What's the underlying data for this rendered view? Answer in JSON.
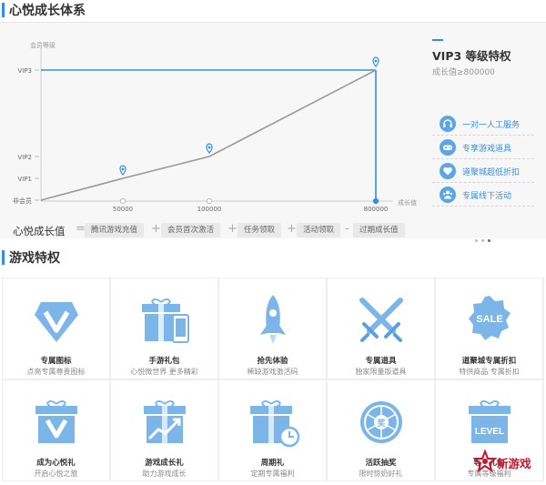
{
  "growth_section": {
    "title": "心悦成长体系",
    "vip_title": "VIP3 等级特权",
    "vip_requirement": "成长值≥800000",
    "perks": [
      {
        "label": "一对一人工服务",
        "icon": "headset-icon"
      },
      {
        "label": "专享游戏道具",
        "icon": "gamepad-icon"
      },
      {
        "label": "道聚城超低折扣",
        "icon": "heart-tag-icon"
      },
      {
        "label": "专属线下活动",
        "icon": "group-icon"
      }
    ]
  },
  "chart_data": {
    "type": "line",
    "ylabel": "会员等级",
    "xlabel": "成长值",
    "y_levels": [
      "非会员",
      "VIP1",
      "VIP2",
      "VIP3"
    ],
    "x_ticks": [
      "50000",
      "100000",
      "800000"
    ],
    "points": [
      {
        "x": "0",
        "level": "非会员"
      },
      {
        "x": "50000",
        "level": "VIP1"
      },
      {
        "x": "100000",
        "level": "VIP2"
      },
      {
        "x": "800000",
        "level": "VIP3"
      }
    ],
    "current_level": "VIP3",
    "current_x": "800000",
    "colors": {
      "curve": "#999999",
      "highlight": "#2f8fe6"
    }
  },
  "formula": {
    "label": "心悦成长值",
    "equals": "=",
    "plus": "+",
    "minus": "-",
    "items": [
      "腾讯游戏充值",
      "会员首次激活",
      "任务领取",
      "活动领取",
      "过期成长值"
    ]
  },
  "privilege_section": {
    "title": "游戏特权",
    "items": [
      {
        "title": "专属图标",
        "desc": "点亮专属尊贵图标",
        "icon": "diamond-v-icon"
      },
      {
        "title": "手游礼包",
        "desc": "心悦微世界 更多精彩",
        "icon": "gift-phone-icon"
      },
      {
        "title": "抢先体验",
        "desc": "稀缺游戏激活码",
        "icon": "rocket-icon"
      },
      {
        "title": "专属道具",
        "desc": "独家限量版道具",
        "icon": "crossed-swords-icon"
      },
      {
        "title": "道聚城专属折扣",
        "desc": "特供商品 专属折扣",
        "icon": "sale-badge-icon"
      },
      {
        "title": "成为心悦礼",
        "desc": "开启心悦之旅",
        "icon": "gift-v-icon"
      },
      {
        "title": "游戏成长礼",
        "desc": "助力游戏成长",
        "icon": "gift-growth-icon"
      },
      {
        "title": "周期礼",
        "desc": "定期专属福利",
        "icon": "gift-clock-icon"
      },
      {
        "title": "活跃抽奖",
        "desc": "限时惊奶好礼",
        "icon": "lottery-wheel-icon",
        "wheel_text": "奖"
      },
      {
        "title": "等级礼包",
        "desc": "专属等级福利",
        "icon": "gift-level-icon",
        "level_text": "LEVEL"
      }
    ],
    "sale_text": "SALE"
  },
  "watermark": {
    "text": "新游戏"
  }
}
